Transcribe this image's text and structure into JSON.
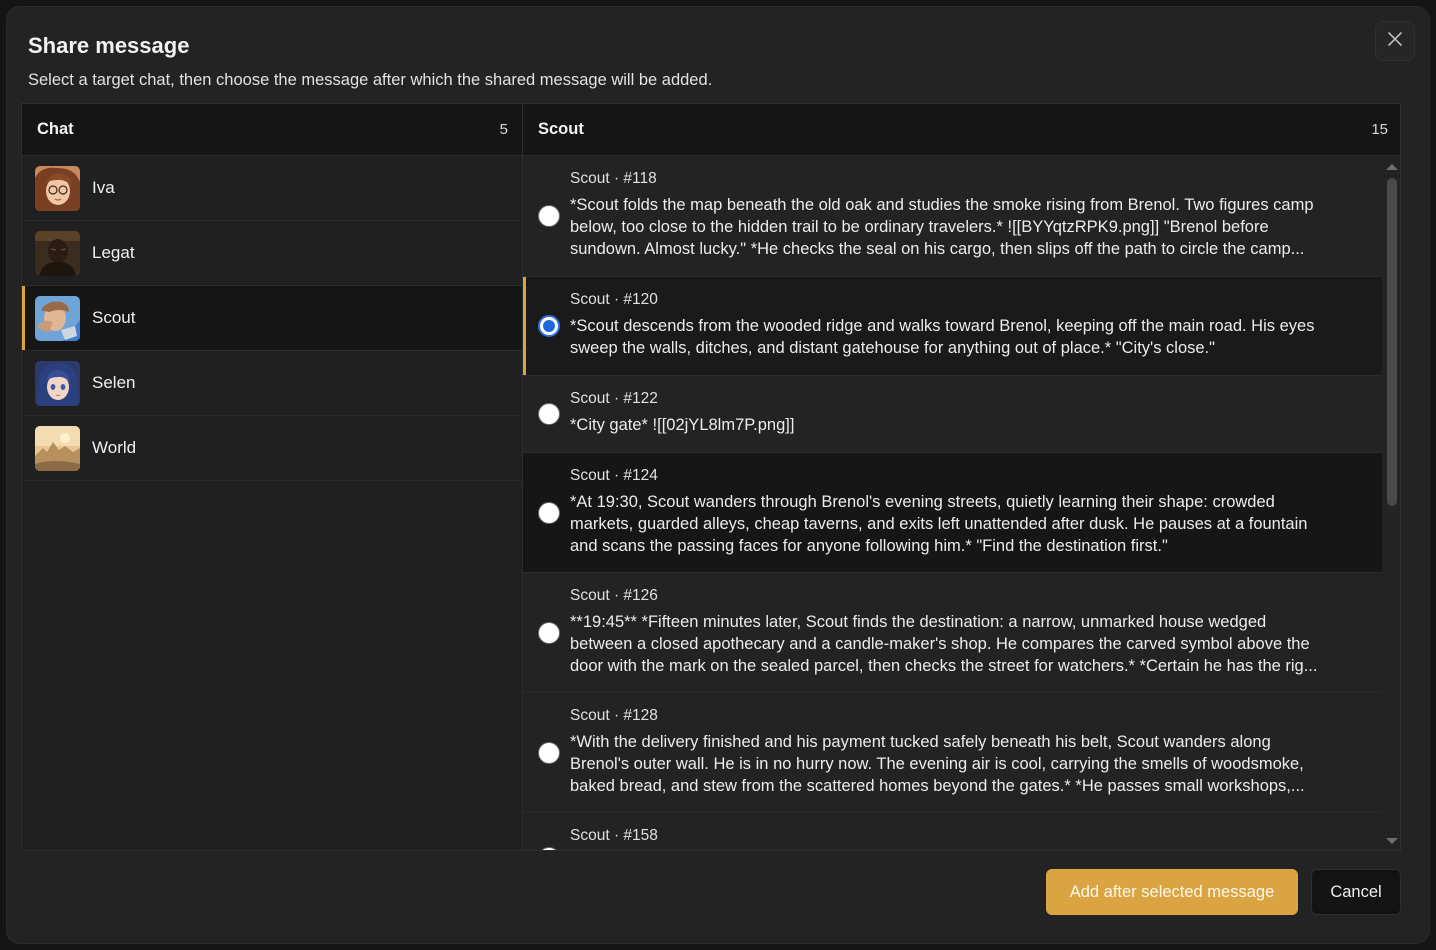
{
  "dialog": {
    "title": "Share message",
    "subtitle": "Select a target chat, then choose the message after which the shared message will be added.",
    "close_icon": "close-icon"
  },
  "chat_panel": {
    "header": "Chat",
    "count": "5",
    "items": [
      {
        "name": "Iva",
        "selected": false
      },
      {
        "name": "Legat",
        "selected": false
      },
      {
        "name": "Scout",
        "selected": true
      },
      {
        "name": "Selen",
        "selected": false
      },
      {
        "name": "World",
        "selected": false
      }
    ]
  },
  "message_panel": {
    "header": "Scout",
    "count": "15",
    "messages": [
      {
        "meta": "Scout · #118",
        "lines": [
          "*Scout folds the map beneath the old oak and studies the smoke rising from Brenol. Two figures camp",
          "below, too close to the hidden trail to be ordinary travelers.* ![[BYYqtzRPK9.png]] \"Brenol before",
          "sundown. Almost lucky.\" *He checks the seal on his cargo, then slips off the path to circle the camp..."
        ],
        "selected": false
      },
      {
        "meta": "Scout · #120",
        "lines": [
          "*Scout descends from the wooded ridge and walks toward Brenol, keeping off the main road. His eyes",
          "sweep the walls, ditches, and distant gatehouse for anything out of place.* \"City's close.\""
        ],
        "selected": true
      },
      {
        "meta": "Scout · #122",
        "lines": [
          "*City gate* ![[02jYL8lm7P.png]]"
        ],
        "selected": false
      },
      {
        "meta": "Scout · #124",
        "lines": [
          "*At 19:30, Scout wanders through Brenol's evening streets, quietly learning their shape: crowded",
          "markets, guarded alleys, cheap taverns, and exits left unattended after dusk. He pauses at a fountain",
          "and scans the passing faces for anyone following him.* \"Find the destination first.\""
        ],
        "selected": false
      },
      {
        "meta": "Scout · #126",
        "lines": [
          "**19:45** *Fifteen minutes later, Scout finds the destination: a narrow, unmarked house wedged",
          "between a closed apothecary and a candle-maker's shop. He compares the carved symbol above the",
          "door with the mark on the sealed parcel, then checks the street for watchers.* *Certain he has the rig..."
        ],
        "selected": false
      },
      {
        "meta": "Scout · #128",
        "lines": [
          "*With the delivery finished and his payment tucked safely beneath his belt, Scout wanders along",
          "Brenol's outer wall. He is in no hurry now. The evening air is cool, carrying the smells of woodsmoke,",
          "baked bread, and stew from the scattered homes beyond the gates.* *He passes small workshops,..."
        ],
        "selected": false
      },
      {
        "meta": "Scout · #158",
        "lines": [],
        "selected": false
      }
    ]
  },
  "footer": {
    "primary_label": "Add after selected message",
    "cancel_label": "Cancel"
  },
  "colors": {
    "accent": "#d9a441",
    "radio_checked": "#1f66dd",
    "panel_header_bg": "#151515",
    "dialog_bg": "#232323"
  }
}
